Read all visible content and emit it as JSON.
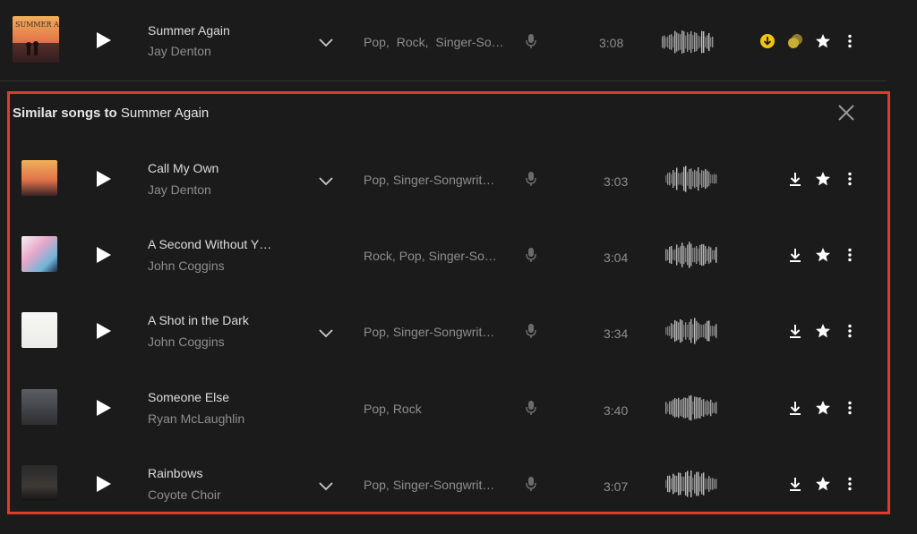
{
  "top_track": {
    "title": "Summer Again",
    "artist": "Jay Denton",
    "genres": [
      "Pop,",
      "Rock,",
      "Singer-So…"
    ],
    "duration": "3:08",
    "art_text": "SUMMER Again"
  },
  "similar": {
    "heading_bold": "Similar songs to",
    "heading_title": "Summer Again",
    "tracks": [
      {
        "title": "Call My Own",
        "artist": "Jay Denton",
        "genres": [
          "Pop,",
          "Singer-Songwrit…"
        ],
        "duration": "3:03",
        "has_versions": true
      },
      {
        "title": "A Second Without Y…",
        "artist": "John Coggins",
        "genres": [
          "Rock,",
          "Pop,",
          "Singer-So…"
        ],
        "duration": "3:04",
        "has_versions": false
      },
      {
        "title": "A Shot in the Dark",
        "artist": "John Coggins",
        "genres": [
          "Pop,",
          "Singer-Songwrit…"
        ],
        "duration": "3:34",
        "has_versions": true
      },
      {
        "title": "Someone Else",
        "artist": "Ryan McLaughlin",
        "genres": [
          "Pop,",
          "Rock"
        ],
        "duration": "3:40",
        "has_versions": false
      },
      {
        "title": "Rainbows",
        "artist": "Coyote Choir",
        "genres": [
          "Pop,",
          "Singer-Songwrit…"
        ],
        "duration": "3:07",
        "has_versions": true
      }
    ]
  },
  "colors": {
    "background": "#1b1b1b",
    "highlight_border": "#e13b2b",
    "download_active": "#f2c511"
  },
  "icons": [
    "play-icon",
    "chevron-down-icon",
    "microphone-icon",
    "waveform",
    "download-icon",
    "star-icon",
    "more-vertical-icon",
    "close-icon",
    "stems-icon"
  ]
}
